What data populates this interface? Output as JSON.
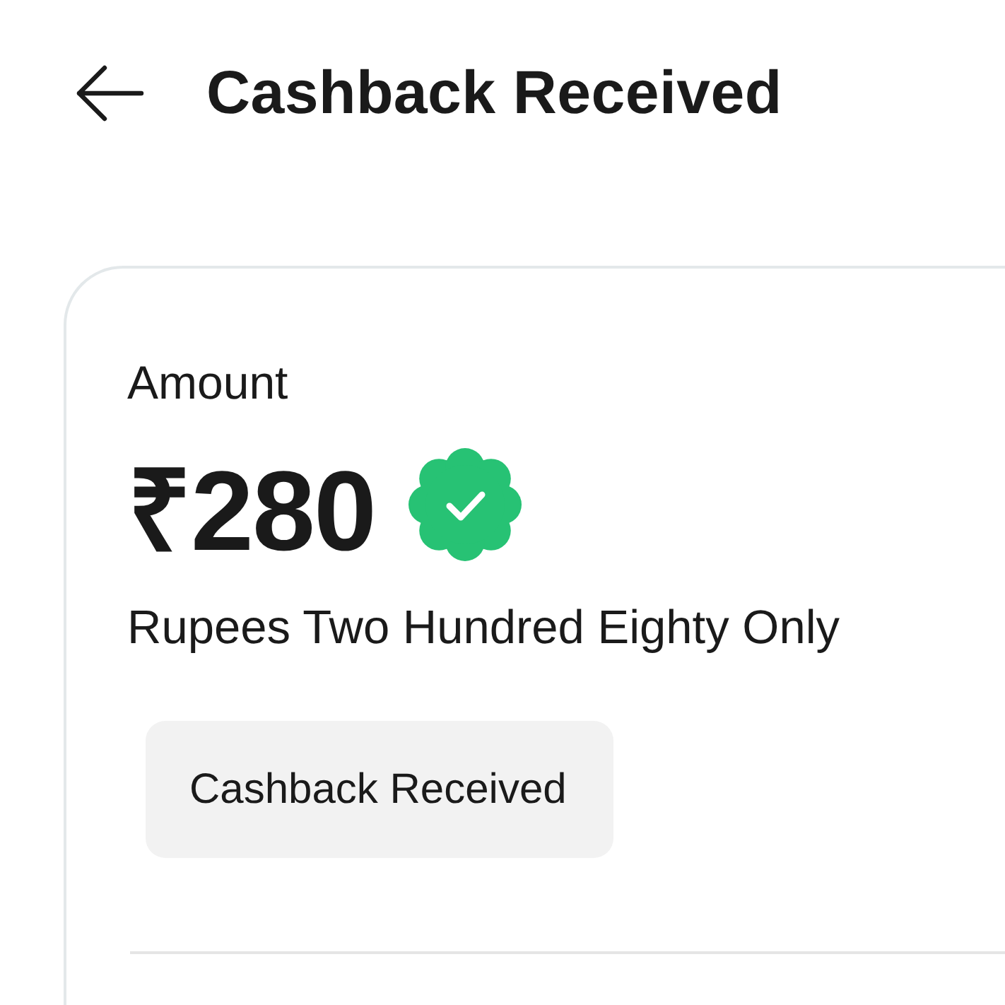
{
  "header": {
    "title": "Cashback Received"
  },
  "card": {
    "label": "Amount",
    "amount": "₹280",
    "verified": true,
    "amount_in_words": "Rupees Two Hundred Eighty Only",
    "status": "Cashback Received"
  }
}
